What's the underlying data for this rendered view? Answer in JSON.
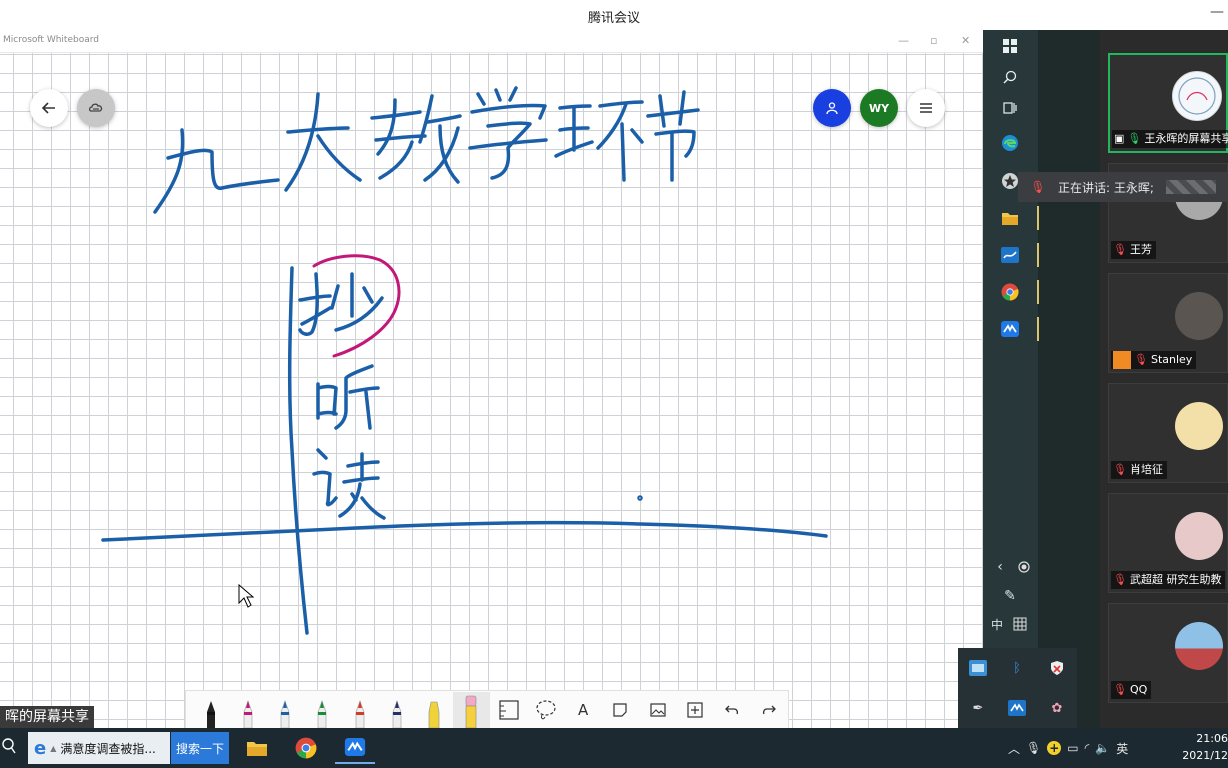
{
  "app": {
    "title": "腾讯会议",
    "minimize_icon": "minimize-icon"
  },
  "whiteboard": {
    "window_title": "Microsoft Whiteboard",
    "controls": [
      "minimize-icon",
      "restore-icon",
      "close-icon"
    ],
    "header_left": {
      "back": "arrow-left-icon",
      "sync": "cloud-sync-icon"
    },
    "header_right": {
      "people": "person-icon",
      "avatar_initials": "WY",
      "menu": "hamburger-icon"
    },
    "share_label": "晖的屏幕共享",
    "ink_colors": {
      "blue": "#1a5fa8",
      "magenta": "#c2187a"
    },
    "toolbar": {
      "pens": [
        {
          "name": "black-pen",
          "color": "#111111"
        },
        {
          "name": "magenta-pen",
          "color": "#c2187a"
        },
        {
          "name": "blue-pen",
          "color": "#1f5fa8"
        },
        {
          "name": "green-pen",
          "color": "#1b8a3a"
        },
        {
          "name": "red-pen",
          "color": "#d33a2a"
        },
        {
          "name": "navy-pen",
          "color": "#23306a"
        },
        {
          "name": "yellow-highlighter",
          "color": "#f0d23a"
        },
        {
          "name": "eraser",
          "color": "#f2a9c6"
        }
      ],
      "tools": [
        "ruler-icon",
        "lasso-icon",
        "text-icon",
        "sticky-note-icon",
        "image-icon",
        "insert-icon",
        "undo-icon",
        "redo-icon"
      ],
      "text_tool_glyph": "A"
    }
  },
  "sidebar": {
    "os_icons": [
      "windows-icon",
      "search-icon",
      "task-view-icon",
      "edge-icon",
      "star-icon",
      "file-explorer-icon",
      "whiteboard-icon",
      "chrome-icon",
      "tencent-meeting-icon"
    ],
    "bottom_icons": [
      "chevron-left-icon",
      "record-icon",
      "pen-settings-icon"
    ],
    "ime_label": "中",
    "keyboard_icon": "keyboard-icon"
  },
  "meeting": {
    "speaking_text": "正在讲话: 王永晖;",
    "participants": [
      {
        "name": "王永晖的屏幕共享",
        "active": true,
        "avatar": "#dfe9f2"
      },
      {
        "name": "王芳",
        "active": false,
        "avatar": "#9a9a9a"
      },
      {
        "name": "Stanley",
        "active": false,
        "avatar": "#5a5550"
      },
      {
        "name": "肖培征",
        "active": false,
        "avatar": "#f3e0a8"
      },
      {
        "name": "武超超 研究生助教",
        "active": false,
        "avatar": "#e7c9c9"
      },
      {
        "name": "QQ",
        "active": false,
        "avatar": "#6ea0c8"
      }
    ]
  },
  "tray_popup_icons": [
    "network-tool-icon",
    "bluetooth-icon",
    "security-icon",
    "pen-icon",
    "whiteboard-tray-icon",
    "flower-icon"
  ],
  "taskbar": {
    "search_icon": "search-icon",
    "ie_task_label": "满意度调查被指...",
    "search_button": "搜索一下",
    "apps": [
      "file-explorer-icon",
      "chrome-icon",
      "tencent-meeting-icon"
    ],
    "tray": [
      "chevron-up-icon",
      "microphone-icon",
      "add-icon",
      "battery-icon",
      "wifi-icon",
      "volume-icon"
    ],
    "ime": "英",
    "time": "21:06",
    "date": "2021/12"
  }
}
